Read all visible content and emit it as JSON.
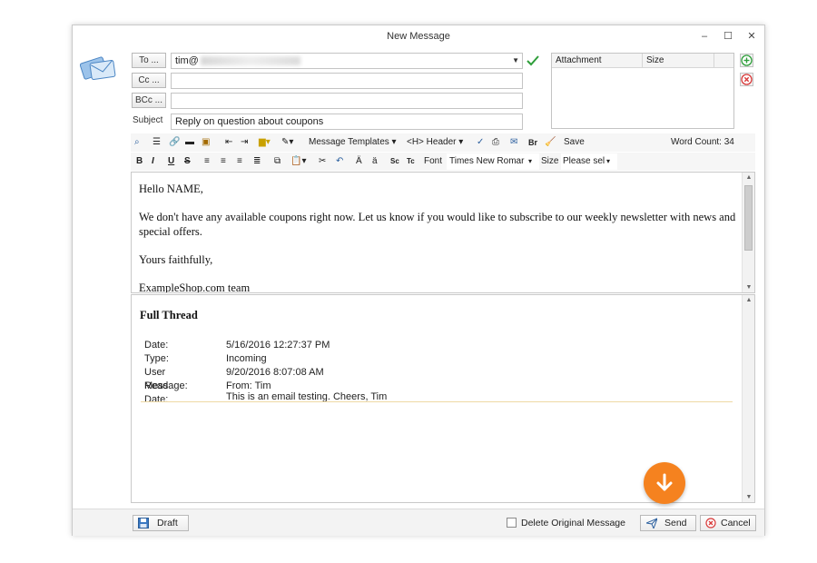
{
  "window": {
    "title": "New Message",
    "minimize_glyph": "–",
    "maximize_glyph": "☐",
    "close_glyph": "✕"
  },
  "header": {
    "to_button": "To ...",
    "cc_button": "Cc ...",
    "bcc_button": "BCc ...",
    "subject_label": "Subject",
    "to_value": "tim@",
    "cc_value": "",
    "bcc_value": "",
    "subject_value": "Reply on question about coupons"
  },
  "attachments": {
    "col_attachment": "Attachment",
    "col_size": "Size"
  },
  "toolbar1": {
    "message_templates": "Message Templates",
    "header_menu": "<H> Header",
    "br_label": "Br",
    "save_label": "Save",
    "word_count": "Word Count: 34"
  },
  "toolbar2": {
    "bold": "B",
    "italic": "I",
    "underline": "U",
    "strike": "S",
    "sc": "Sc",
    "tc": "Tc",
    "font_label": "Font",
    "font_value": "Times New Romar",
    "size_label": "Size",
    "size_value": "Please sel"
  },
  "editor": {
    "greeting": "Hello NAME,",
    "body": "We don't have any available coupons right now. Let us know if you would like to subscribe to our weekly newsletter with news and special offers.",
    "closing": "Yours faithfully,",
    "signature": "ExampleShop.com team"
  },
  "thread": {
    "title": "Full Thread",
    "date_label": "Date:",
    "date_value": "5/16/2016 12:27:37 PM",
    "type_label": "Type:",
    "type_value": "Incoming",
    "read_label": "User Read Date:",
    "read_value": "9/20/2016 8:07:08 AM",
    "message_label": "Message:",
    "message_from": "From: Tim",
    "message_body": "This is an email testing. Cheers, Tim"
  },
  "footer": {
    "draft": "Draft",
    "delete_original": "Delete Original Message",
    "send": "Send",
    "cancel": "Cancel"
  },
  "colors": {
    "accent_orange": "#f5821f",
    "add_green": "#2e9e3a",
    "remove_red": "#d83a3a",
    "separator_gold": "#efd9a5"
  }
}
